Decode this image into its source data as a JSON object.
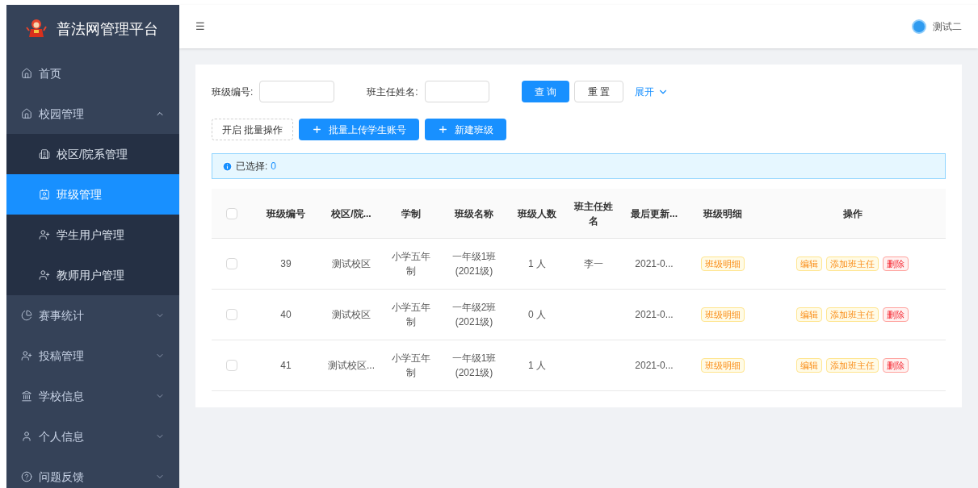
{
  "sidebar": {
    "title": "普法网管理平台",
    "items": [
      {
        "label": "首页",
        "kind": "top",
        "selected": false
      },
      {
        "label": "校园管理",
        "kind": "group",
        "expanded": true,
        "children": [
          {
            "label": "校区/院系管理",
            "selected": false
          },
          {
            "label": "班级管理",
            "selected": true
          },
          {
            "label": "学生用户管理",
            "selected": false
          },
          {
            "label": "教师用户管理",
            "selected": false
          }
        ]
      },
      {
        "label": "赛事统计",
        "kind": "group",
        "expanded": false
      },
      {
        "label": "投稿管理",
        "kind": "group",
        "expanded": false
      },
      {
        "label": "学校信息",
        "kind": "group",
        "expanded": false
      },
      {
        "label": "个人信息",
        "kind": "group",
        "expanded": false
      },
      {
        "label": "问题反馈",
        "kind": "group",
        "expanded": false
      }
    ]
  },
  "header": {
    "menu_icon": "☰",
    "user": "测试二"
  },
  "filters": [
    {
      "label": "班级编号:"
    },
    {
      "label": "班主任姓名:"
    }
  ],
  "search_buttons": [
    {
      "label": "查 询",
      "kind": "primary"
    },
    {
      "label": "重 置",
      "kind": "default"
    }
  ],
  "expand_link": "展开",
  "actions": [
    {
      "label": "开启 批量操作",
      "kind": "dashed"
    },
    {
      "label": "批量上传学生账号",
      "kind": "add"
    },
    {
      "label": "新建班级",
      "kind": "add"
    }
  ],
  "selection_info": {
    "label": "已选择:",
    "count": "0"
  },
  "table": {
    "columns": [
      "班级编号",
      "校区/院...",
      "学制",
      "班级名称",
      "班级人数",
      "班主任姓名",
      "最后更新...",
      "班级明细",
      "操作"
    ],
    "all_checked": false,
    "rows": [
      {
        "checked": false,
        "cells": [
          "39",
          "测试校区",
          "小学五年制",
          "一年级1班(2021级)",
          "1 人",
          "李一",
          "2021-0..."
        ],
        "detail": "班级明细",
        "ops": [
          {
            "label": "编辑",
            "kind": "warn"
          },
          {
            "label": "添加班主任",
            "kind": "warn"
          },
          {
            "label": "删除",
            "kind": "danger"
          }
        ]
      },
      {
        "checked": false,
        "cells": [
          "40",
          "测试校区",
          "小学五年制",
          "一年级2班(2021级)",
          "0 人",
          "",
          "2021-0..."
        ],
        "detail": "班级明细",
        "ops": [
          {
            "label": "编辑",
            "kind": "warn"
          },
          {
            "label": "添加班主任",
            "kind": "warn"
          },
          {
            "label": "删除",
            "kind": "danger"
          }
        ]
      },
      {
        "checked": false,
        "cells": [
          "41",
          "测试校区...",
          "小学五年制",
          "一年级1班(2021级)",
          "1 人",
          "",
          "2021-0..."
        ],
        "detail": "班级明细",
        "ops": [
          {
            "label": "编辑",
            "kind": "warn"
          },
          {
            "label": "添加班主任",
            "kind": "warn"
          },
          {
            "label": "删除",
            "kind": "danger"
          }
        ]
      }
    ]
  }
}
